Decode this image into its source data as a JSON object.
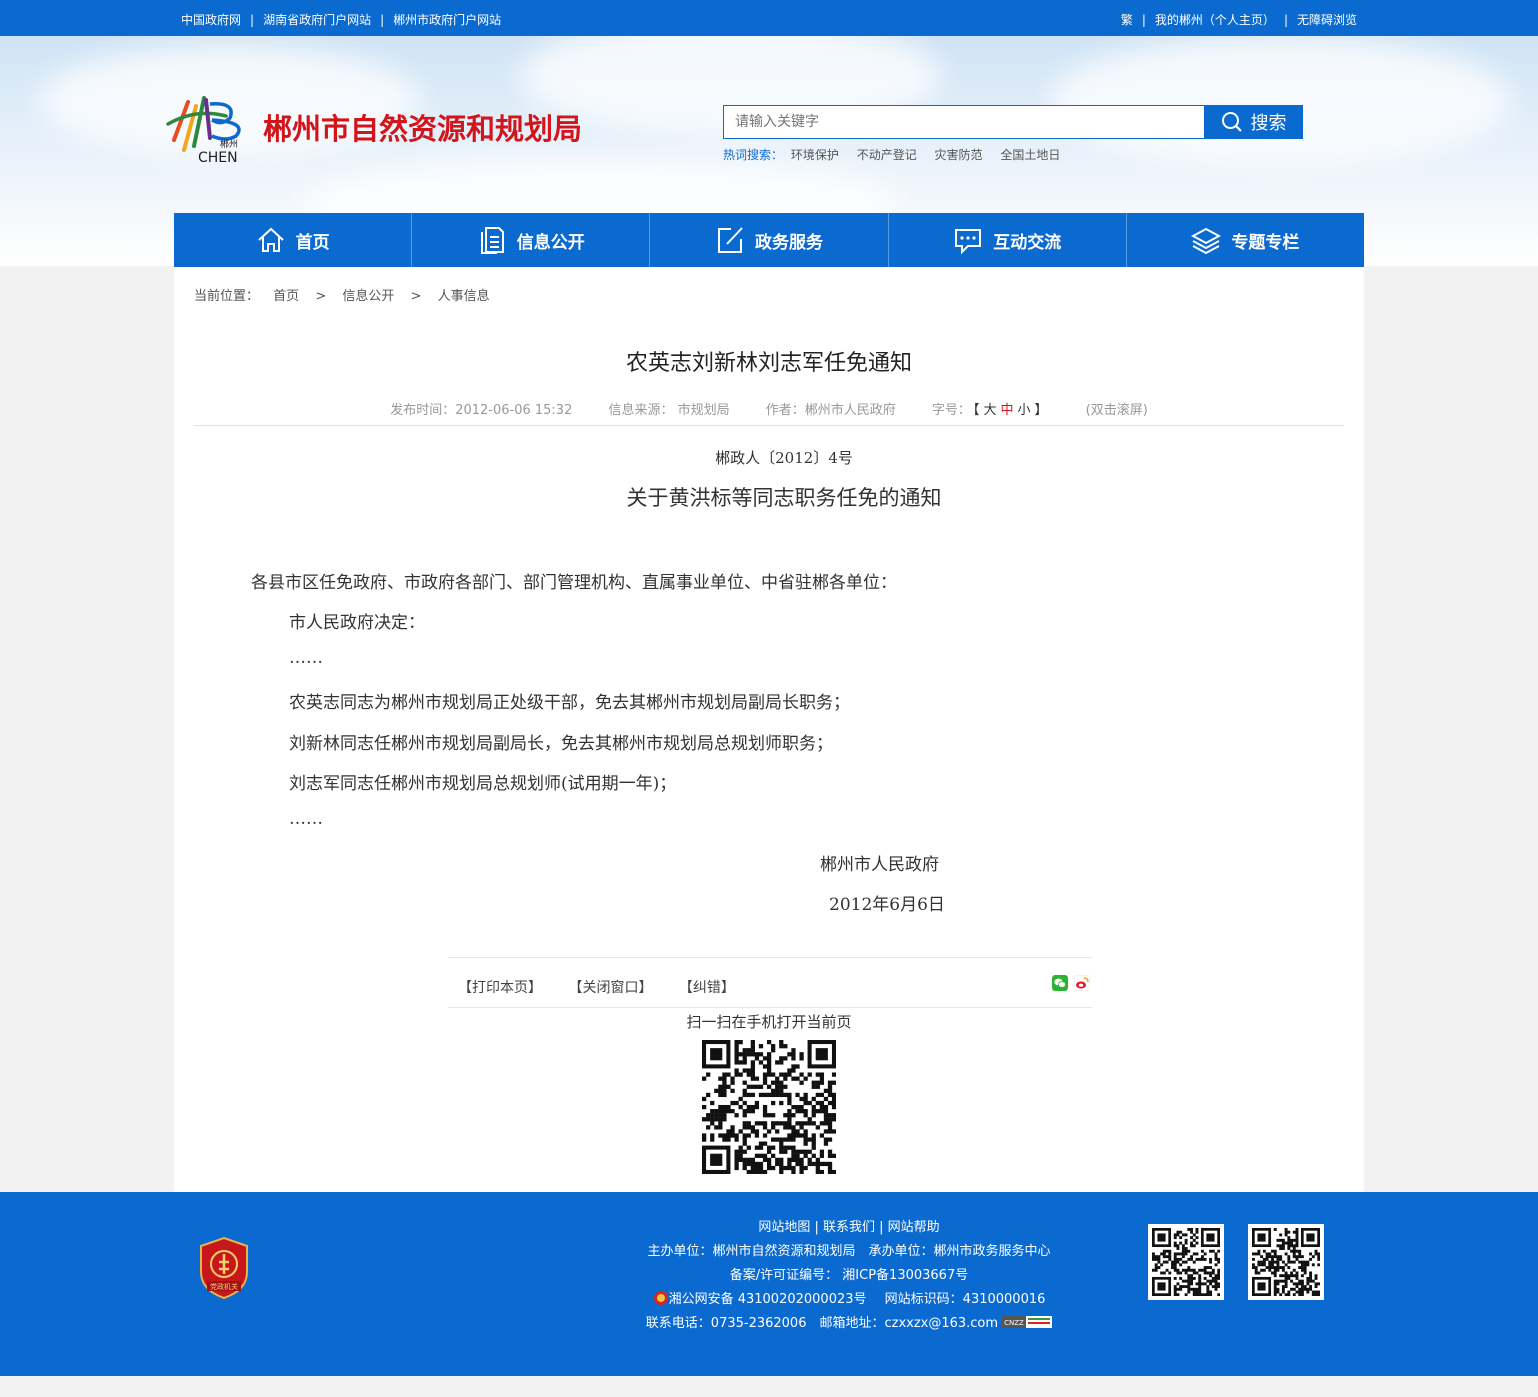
{
  "topbar": {
    "left_links": [
      "中国政府网",
      "湖南省政府门户网站",
      "郴州市政府门户网站"
    ],
    "right_links": [
      "繁",
      "我的郴州（个人主页）",
      "无障碍浏览"
    ]
  },
  "header": {
    "logo_text_small": "郴州",
    "logo_text": "CHEN",
    "site_title": "郴州市自然资源和规划局",
    "search_placeholder": "请输入关键字",
    "search_button": "搜索",
    "hot_label": "热词搜索：",
    "hot_words": [
      "环境保护",
      "不动产登记",
      "灾害防范",
      "全国土地日"
    ]
  },
  "nav": [
    {
      "label": "首页",
      "icon": "home-icon"
    },
    {
      "label": "信息公开",
      "icon": "document-icon"
    },
    {
      "label": "政务服务",
      "icon": "edit-icon"
    },
    {
      "label": "互动交流",
      "icon": "chat-icon"
    },
    {
      "label": "专题专栏",
      "icon": "layers-icon"
    }
  ],
  "breadcrumb": {
    "label": "当前位置：",
    "items": [
      "首页",
      "信息公开",
      "人事信息"
    ],
    "separator": ">"
  },
  "article": {
    "title": "农英志刘新林刘志军任免通知",
    "publish_time": "发布时间：2012-06-06 15:32",
    "source": "信息来源： 市规划局",
    "author": "作者：郴州市人民政府",
    "font_label": "字号：",
    "font_open": "【",
    "font_large": "大",
    "font_medium": "中",
    "font_small": "小",
    "font_close": "】",
    "dblclick": "(双击滚屏)",
    "doc_number": "郴政人〔2012〕4号",
    "doc_title": "关于黄洪标等同志职务任免的通知",
    "paragraphs": [
      "各县市区任免政府、市政府各部门、部门管理机构、直属事业单位、中省驻郴各单位：",
      "市人民政府决定：",
      "……",
      "农英志同志为郴州市规划局正处级干部，免去其郴州市规划局副局长职务；",
      "刘新林同志任郴州市规划局副局长，免去其郴州市规划局总规划师职务；",
      "刘志军同志任郴州市规划局总规划师(试用期一年)；",
      "……"
    ],
    "signer": "郴州市人民政府",
    "sign_date": "2012年6月6日"
  },
  "tools": {
    "print": "【打印本页】",
    "close": "【关闭窗口】",
    "error": "【纠错】",
    "scan_text": "扫一扫在手机打开当前页"
  },
  "footer": {
    "links": [
      "网站地图",
      "联系我们",
      "网站帮助"
    ],
    "host": "主办单位：郴州市自然资源和规划局　承办单位：郴州市政务服务中心",
    "icp": "备案/许可证编号： 湘ICP备13003667号",
    "police": "湘公网安备 43100202000023号",
    "site_code": "网站标识码：4310000016",
    "contact": "联系电话：0735-2362006　邮箱地址：czxxzx@163.com",
    "badge_text": "党政机关",
    "cnzz": "CNZZ"
  },
  "colors": {
    "brand_blue": "#0b6ad0",
    "title_red": "#d2141b"
  }
}
